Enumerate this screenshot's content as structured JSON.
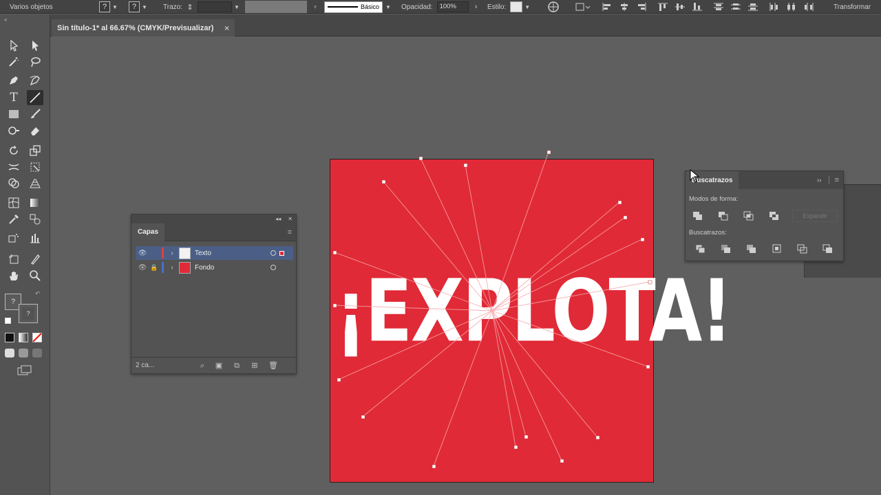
{
  "control_bar": {
    "selection_label": "Varios objetos",
    "fill_unknown": "?",
    "stroke_unknown": "?",
    "stroke_label": "Trazo:",
    "brush_label": "Básico",
    "opacity_label": "Opacidad:",
    "opacity_value": "100%",
    "style_label": "Estilo:",
    "transform_label": "Transformar"
  },
  "document_tab": {
    "title": "Sin título-1* al 66.67% (CMYK/Previsualizar)",
    "close_glyph": "×"
  },
  "toolbar": {
    "tools": [
      "selection-tool",
      "direct-selection-tool",
      "magic-wand-tool",
      "lasso-tool",
      "pen-tool",
      "curvature-tool",
      "type-tool",
      "line-segment-tool",
      "rectangle-tool",
      "paintbrush-tool",
      "shaper-tool",
      "eraser-tool",
      "rotate-tool",
      "scale-tool",
      "width-tool",
      "free-transform-tool",
      "shape-builder-tool",
      "perspective-grid-tool",
      "mesh-tool",
      "gradient-tool",
      "eyedropper-tool",
      "blend-tool",
      "symbol-sprayer-tool",
      "column-graph-tool",
      "artboard-tool",
      "slice-tool",
      "hand-tool",
      "zoom-tool"
    ],
    "active_tool": "line-segment-tool",
    "type_glyph": "T",
    "fill_unknown": "?",
    "stroke_unknown": "?"
  },
  "artwork": {
    "headline": "¡EXPLOTA!",
    "background_color": "#e12a37",
    "text_color": "#ffffff"
  },
  "layers_panel": {
    "tab": "Capas",
    "layers": [
      {
        "name": "Texto",
        "color": "#e0413f",
        "selected": true
      },
      {
        "name": "Fondo",
        "color": "#4a6fd1",
        "selected": false
      }
    ],
    "footer_count": "2 ca..."
  },
  "pathfinder_panel": {
    "tab": "Buscatrazos",
    "shape_modes_label": "Modos de forma:",
    "expand_label": "Expandir",
    "pathfinders_label": "Buscatrazos:"
  },
  "colors": {
    "ui_bg": "#5f5f5f",
    "panel_bg": "#535353",
    "selection_blue": "#4b5f86",
    "artboard_red": "#e12a37"
  }
}
